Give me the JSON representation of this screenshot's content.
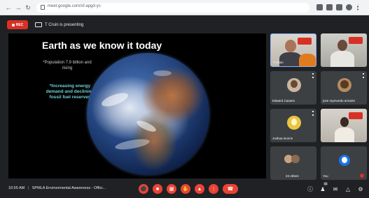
{
  "browser": {
    "url": "meet.google.com/xf-apgd-ys",
    "nav_icons": [
      "back-arrow-icon",
      "forward-arrow-icon",
      "reload-icon"
    ]
  },
  "recording": {
    "label": "REC"
  },
  "presenting": {
    "text": "T Cruin is presenting"
  },
  "slide": {
    "title": "Earth as we know it today",
    "bullet1": "*Population 7.9 billion and rising",
    "bullet2": "*Increasing energy demand and declining fossil fuel reserves"
  },
  "participants": [
    {
      "name": "T Cruin"
    },
    {
      "name": ""
    },
    {
      "name": "Edward Casario"
    },
    {
      "name": "jose raymundo arnante"
    },
    {
      "name": "Joshua Isonris"
    },
    {
      "name": ""
    },
    {
      "name": "23 others"
    },
    {
      "name": "You"
    }
  ],
  "bottom_bar": {
    "time": "10:55 AM",
    "separator": "|",
    "meeting_name": "SPMLA Environmental Awareness - Offici...",
    "people_count": "31"
  },
  "colors": {
    "accent_red": "#ea4335",
    "bg": "#202124",
    "tile": "#3c4043",
    "slide_accent": "#6fd3d8"
  }
}
